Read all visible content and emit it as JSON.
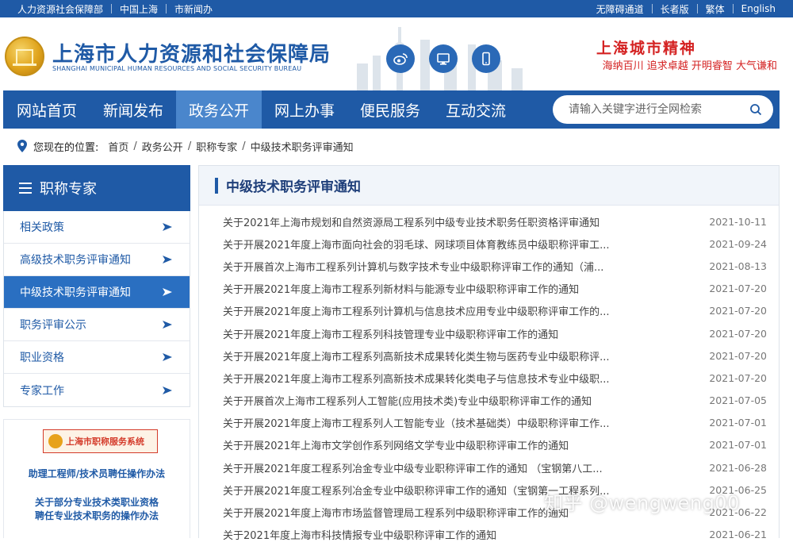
{
  "topbar": {
    "left_links": [
      "人力资源社会保障部",
      "中国上海",
      "市新闻办"
    ],
    "right_links": [
      "无障碍通道",
      "长者版",
      "繁体",
      "English"
    ]
  },
  "header": {
    "title": "上海市人力资源和社会保障局",
    "title_en": "SHANGHAI MUNICIPAL HUMAN RESOURCES AND SOCIAL SECURITY BUREAU",
    "icons": [
      "weibo-icon",
      "desktop-icon",
      "mobile-icon"
    ],
    "spirit_title": "上海城市精神",
    "spirit_slogan": "海纳百川 追求卓越 开明睿智 大气谦和"
  },
  "nav": {
    "items": [
      "网站首页",
      "新闻发布",
      "政务公开",
      "网上办事",
      "便民服务",
      "互动交流"
    ],
    "active_index": 2,
    "search_placeholder": "请输入关键字进行全网检索"
  },
  "breadcrumb": {
    "label": "您现在的位置:",
    "items": [
      "首页",
      "政务公开",
      "职称专家",
      "中级技术职务评审通知"
    ]
  },
  "sidebar": {
    "title": "职称专家",
    "items": [
      {
        "label": "相关政策",
        "active": false
      },
      {
        "label": "高级技术职务评审通知",
        "active": false
      },
      {
        "label": "中级技术职务评审通知",
        "active": true
      },
      {
        "label": "职务评审公示",
        "active": false
      },
      {
        "label": "职业资格",
        "active": false
      },
      {
        "label": "专家工作",
        "active": false
      }
    ],
    "banner": "上海市职称服务系统",
    "link1": "助理工程师/技术员聘任操作办法",
    "link2_line1": "关于部分专业技术类职业资格",
    "link2_line2": "聘任专业技术职务的操作办法"
  },
  "panel": {
    "title": "中级技术职务评审通知",
    "news": [
      {
        "title": "关于2021年上海市规划和自然资源局工程系列中级专业技术职务任职资格评审通知",
        "date": "2021-10-11"
      },
      {
        "title": "关于开展2021年度上海市面向社会的羽毛球、网球项目体育教练员中级职称评审工...",
        "date": "2021-09-24"
      },
      {
        "title": "关于开展首次上海市工程系列计算机与数字技术专业中级职称评审工作的通知（浦...",
        "date": "2021-08-13"
      },
      {
        "title": "关于开展2021年度上海市工程系列新材料与能源专业中级职称评审工作的通知",
        "date": "2021-07-20"
      },
      {
        "title": "关于开展2021年度上海市工程系列计算机与信息技术应用专业中级职称评审工作的...",
        "date": "2021-07-20"
      },
      {
        "title": "关于开展2021年度上海市工程系列科技管理专业中级职称评审工作的通知",
        "date": "2021-07-20"
      },
      {
        "title": "关于开展2021年度上海市工程系列高新技术成果转化类生物与医药专业中级职称评...",
        "date": "2021-07-20"
      },
      {
        "title": "关于开展2021年度上海市工程系列高新技术成果转化类电子与信息技术专业中级职...",
        "date": "2021-07-20"
      },
      {
        "title": "关于开展首次上海市工程系列人工智能(应用技术类)专业中级职称评审工作的通知",
        "date": "2021-07-05"
      },
      {
        "title": "关于开展2021年度上海市工程系列人工智能专业（技术基础类）中级职称评审工作...",
        "date": "2021-07-01"
      },
      {
        "title": "关于开展2021年上海市文学创作系列网络文学专业中级职称评审工作的通知",
        "date": "2021-07-01"
      },
      {
        "title": "关于开展2021年度工程系列冶金专业中级专业职称评审工作的通知 （宝钢第八工...",
        "date": "2021-06-28"
      },
      {
        "title": "关于开展2021年度工程系列冶金专业中级职称评审工作的通知（宝钢第一工程系列...",
        "date": "2021-06-25"
      },
      {
        "title": "关于开展2021年度上海市市场监督管理局工程系列中级职称评审工作的通知",
        "date": "2021-06-22"
      },
      {
        "title": "关于2021年度上海市科技情报专业中级职称评审工作的通知",
        "date": "2021-06-21"
      }
    ]
  },
  "watermark": "知乎 @wengweng00",
  "colors": {
    "primary": "#1f5aa6",
    "nav_active": "#4a86cc",
    "accent_red": "#d42222"
  }
}
